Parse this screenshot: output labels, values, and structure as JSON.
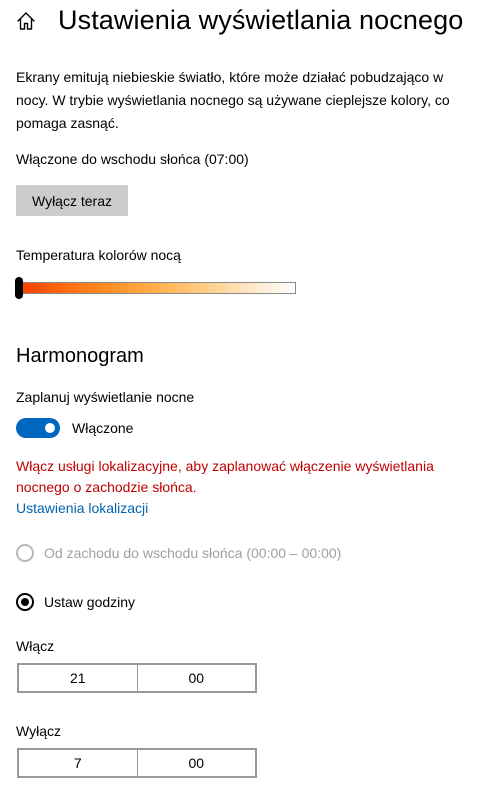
{
  "header": {
    "home_icon": "home-icon",
    "title": "Ustawienia wyświetlania nocnego"
  },
  "description": "Ekrany emitują niebieskie światło, które może działać pobudzająco w nocy. W trybie wyświetlania nocnego są używane cieplejsze kolory, co pomaga zasnąć.",
  "status": "Włączone do wschodu słońca (07:00)",
  "turn_off_button": "Wyłącz teraz",
  "temperature": {
    "label": "Temperatura kolorów nocą",
    "value_fraction": 0.0
  },
  "schedule": {
    "heading": "Harmonogram",
    "toggle_label": "Zaplanuj wyświetlanie nocne",
    "toggle_state": "Włączone",
    "toggle_on": true,
    "warning": "Włącz usługi lokalizacyjne, aby zaplanować włączenie wyświetlania nocnego o zachodzie słońca.",
    "location_link": "Ustawienia lokalizacji",
    "option_sunset": "Od zachodu do wschodu słońca (00:00 – 00:00)",
    "option_custom": "Ustaw godziny",
    "selected_option": "custom"
  },
  "turn_on_time": {
    "label": "Włącz",
    "hour": "21",
    "minute": "00"
  },
  "turn_off_time": {
    "label": "Wyłącz",
    "hour": "7",
    "minute": "00"
  },
  "colors": {
    "accent": "#0067c0",
    "warning": "#c00000",
    "link": "#0063b1"
  }
}
